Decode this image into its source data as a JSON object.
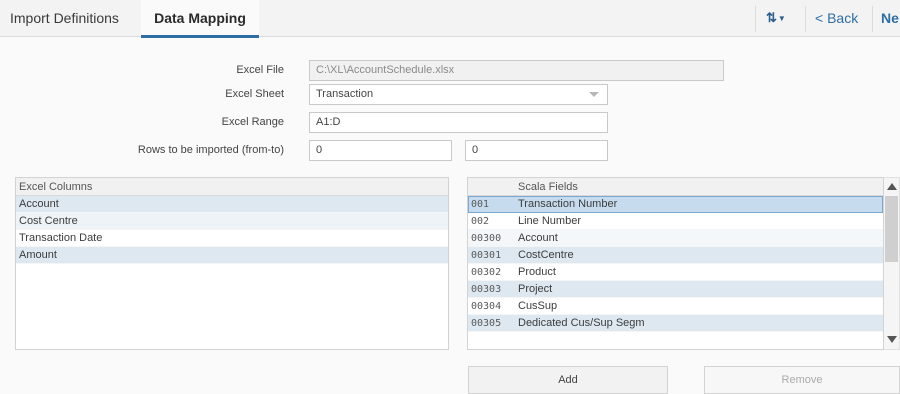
{
  "tabs": {
    "import_definitions": "Import Definitions",
    "data_mapping": "Data Mapping"
  },
  "toolbar": {
    "sort_icon": "sort-arrows-icon",
    "back_label": "< Back",
    "next_label": "Ne"
  },
  "form": {
    "excel_file": {
      "label": "Excel File",
      "value": "C:\\XL\\AccountSchedule.xlsx"
    },
    "excel_sheet": {
      "label": "Excel Sheet",
      "value": "Transaction"
    },
    "excel_range": {
      "label": "Excel Range",
      "value": "A1:D"
    },
    "rows": {
      "label": "Rows to be imported (from-to)",
      "from": "0",
      "to": "0"
    }
  },
  "excel_columns": {
    "header": "Excel Columns",
    "items": [
      "Account",
      "Cost Centre",
      "Transaction Date",
      "Amount"
    ]
  },
  "scala_fields": {
    "header": "Scala Fields",
    "items": [
      {
        "code": "001",
        "name": "Transaction Number"
      },
      {
        "code": "002",
        "name": "Line Number"
      },
      {
        "code": "00300",
        "name": "Account"
      },
      {
        "code": "00301",
        "name": "CostCentre"
      },
      {
        "code": "00302",
        "name": "Product"
      },
      {
        "code": "00303",
        "name": "Project"
      },
      {
        "code": "00304",
        "name": "CusSup"
      },
      {
        "code": "00305",
        "name": "Dedicated Cus/Sup Segm"
      }
    ]
  },
  "buttons": {
    "add": "Add",
    "remove": "Remove"
  },
  "colors": {
    "accent": "#2f6ea5",
    "row_alt": "#dde8f1",
    "row_selected": "#c6dcee"
  }
}
